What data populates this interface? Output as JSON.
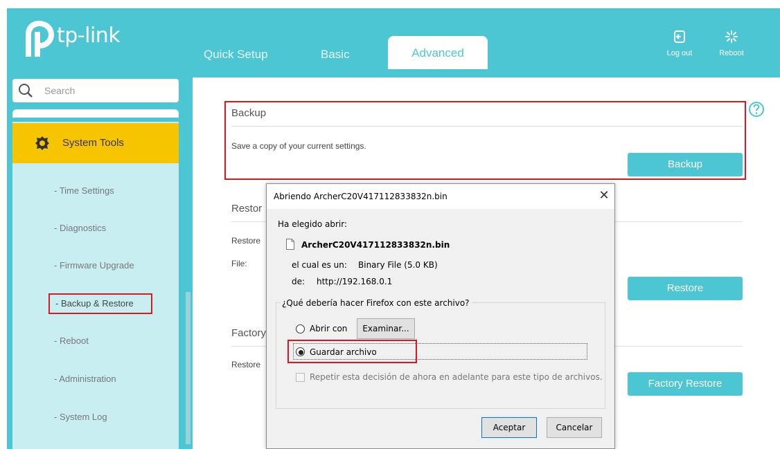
{
  "brand": {
    "name": "tp-link"
  },
  "tabs": {
    "quick_setup": "Quick Setup",
    "basic": "Basic",
    "advanced": "Advanced"
  },
  "top_actions": {
    "logout": "Log out",
    "reboot": "Reboot"
  },
  "sidebar": {
    "search_placeholder": "Search",
    "section": "System Tools",
    "items": [
      {
        "label": "- Time Settings"
      },
      {
        "label": "- Diagnostics"
      },
      {
        "label": "- Firmware Upgrade"
      },
      {
        "label": "- Backup & Restore"
      },
      {
        "label": "- Reboot"
      },
      {
        "label": "- Administration"
      },
      {
        "label": "- System Log"
      }
    ]
  },
  "main": {
    "backup": {
      "title": "Backup",
      "description": "Save a copy of your current settings.",
      "button": "Backup"
    },
    "restore": {
      "title": "Restor",
      "description": "Restore",
      "file_label": "File:",
      "button": "Restore"
    },
    "factory": {
      "title": "Factory",
      "description": "Restore",
      "button": "Factory Restore"
    }
  },
  "dialog": {
    "title": "Abriendo ArcherC20V417112833832n.bin",
    "close": "✕",
    "chosen_label": "Ha elegido abrir:",
    "filename": "ArcherC20V417112833832n.bin",
    "type_label": "el cual es un:",
    "type_value": "Binary File (5.0 KB)",
    "from_label": "de:",
    "from_value": "http://192.168.0.1",
    "question": "¿Qué debería hacer Firefox con este archivo?",
    "open_with_label": "Abrir con",
    "browse_button": "Examinar...",
    "save_label": "Guardar archivo",
    "repeat_label": "Repetir esta decisión de ahora en adelante para este tipo de archivos.",
    "accept": "Aceptar",
    "cancel": "Cancelar"
  },
  "colors": {
    "brand_teal": "#4dc6d3",
    "menu_yellow": "#f7c500",
    "highlight_red": "#e0141c",
    "menu_bg": "#c9eef2"
  }
}
